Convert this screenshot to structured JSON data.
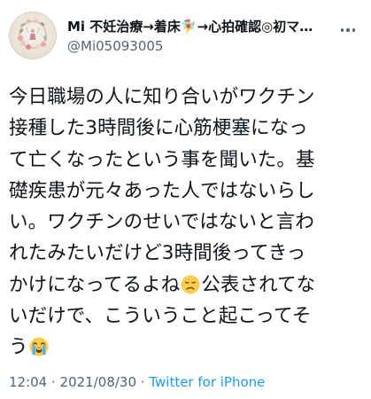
{
  "author": {
    "display_name": "Mi 不妊治療→着床🧚‍♀️→心拍確認◎初マ…",
    "handle": "@Mi05093005"
  },
  "tweet": {
    "lines": [
      "今日職場の人に知り合いがワクチン",
      "接種した3時間後に心筋梗塞になっ",
      "て亡くなったという事を聞いた。基",
      "礎疾患が元々あった人ではないらし",
      "い。ワクチンのせいではないと言わ",
      "れたみたいだけど3時間後ってきっ",
      "かけになってるよね",
      "公表されてな",
      "いだけで、こういうこと起こってそ",
      "う"
    ],
    "emojis": [
      "disappointed-face-emoji",
      "loudly-crying-face-emoji"
    ]
  },
  "meta": {
    "time": "12:04",
    "separator": " · ",
    "date": "2021/08/30",
    "source": "Twitter for iPhone"
  },
  "icons": {
    "avatar": "floral-wreath-avatar",
    "more": "more-options-icon"
  },
  "colors": {
    "text": "#0f1419",
    "secondary": "#536471",
    "link": "#1d9bf0"
  }
}
